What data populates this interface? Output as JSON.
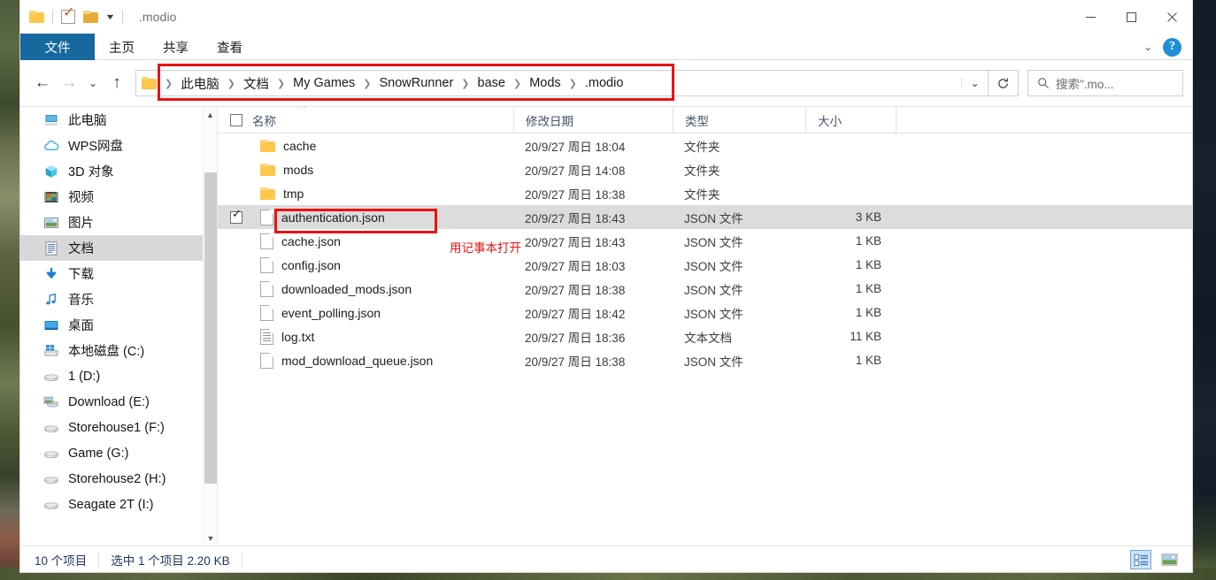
{
  "window": {
    "title": ".modio",
    "quick_access": [
      {
        "name": "folder-icon",
        "label": ""
      },
      {
        "name": "properties-icon",
        "label": ""
      },
      {
        "name": "new-folder-icon",
        "label": ""
      },
      {
        "name": "customize-caret-icon",
        "label": ""
      }
    ],
    "controls": {
      "minimize": "minimize-icon",
      "maximize": "maximize-icon",
      "close": "close-icon"
    }
  },
  "ribbon": {
    "tabs": [
      {
        "label": "文件",
        "active": true
      },
      {
        "label": "主页",
        "active": false
      },
      {
        "label": "共享",
        "active": false
      },
      {
        "label": "查看",
        "active": false
      }
    ],
    "collapse_label": "⌄",
    "help_label": "?"
  },
  "address": {
    "back": "←",
    "forward": "→",
    "recent": "⌄",
    "up": "↑",
    "breadcrumbs": [
      "此电脑",
      "文档",
      "My Games",
      "SnowRunner",
      "base",
      "Mods",
      ".modio"
    ],
    "separator": "❯",
    "dropdown": "⌄",
    "refresh": "↻",
    "search_placeholder": "搜索\".mo..."
  },
  "sidebar": {
    "items": [
      {
        "label": "此电脑",
        "icon": "computer-icon",
        "selected": false
      },
      {
        "label": "WPS网盘",
        "icon": "cloud-icon",
        "selected": false
      },
      {
        "label": "3D 对象",
        "icon": "cube-icon",
        "selected": false
      },
      {
        "label": "视频",
        "icon": "video-icon",
        "selected": false
      },
      {
        "label": "图片",
        "icon": "picture-icon",
        "selected": false
      },
      {
        "label": "文档",
        "icon": "document-icon",
        "selected": true
      },
      {
        "label": "下载",
        "icon": "download-icon",
        "selected": false
      },
      {
        "label": "音乐",
        "icon": "music-icon",
        "selected": false
      },
      {
        "label": "桌面",
        "icon": "desktop-icon",
        "selected": false
      },
      {
        "label": "本地磁盘 (C:)",
        "icon": "system-drive-icon",
        "selected": false
      },
      {
        "label": "1 (D:)",
        "icon": "drive-icon",
        "selected": false
      },
      {
        "label": "Download (E:)",
        "icon": "drive-picture-icon",
        "selected": false
      },
      {
        "label": "Storehouse1 (F:)",
        "icon": "drive-icon",
        "selected": false
      },
      {
        "label": "Game (G:)",
        "icon": "drive-icon",
        "selected": false
      },
      {
        "label": "Storehouse2 (H:)",
        "icon": "drive-icon",
        "selected": false
      },
      {
        "label": "Seagate 2T (I:)",
        "icon": "drive-icon",
        "selected": false
      }
    ]
  },
  "filelist": {
    "columns": [
      "名称",
      "修改日期",
      "类型",
      "大小"
    ],
    "sort_indicator": "⌃",
    "rows": [
      {
        "name": "cache",
        "date": "20/9/27 周日 18:04",
        "type": "文件夹",
        "size": "",
        "kind": "folder",
        "checked": false,
        "selected": false
      },
      {
        "name": "mods",
        "date": "20/9/27 周日 14:08",
        "type": "文件夹",
        "size": "",
        "kind": "folder",
        "checked": false,
        "selected": false
      },
      {
        "name": "tmp",
        "date": "20/9/27 周日 18:38",
        "type": "文件夹",
        "size": "",
        "kind": "folder",
        "checked": false,
        "selected": false
      },
      {
        "name": "authentication.json",
        "date": "20/9/27 周日 18:43",
        "type": "JSON 文件",
        "size": "3 KB",
        "kind": "file",
        "checked": true,
        "selected": true
      },
      {
        "name": "cache.json",
        "date": "20/9/27 周日 18:43",
        "type": "JSON 文件",
        "size": "1 KB",
        "kind": "file",
        "checked": false,
        "selected": false
      },
      {
        "name": "config.json",
        "date": "20/9/27 周日 18:03",
        "type": "JSON 文件",
        "size": "1 KB",
        "kind": "file",
        "checked": false,
        "selected": false
      },
      {
        "name": "downloaded_mods.json",
        "date": "20/9/27 周日 18:38",
        "type": "JSON 文件",
        "size": "1 KB",
        "kind": "file",
        "checked": false,
        "selected": false
      },
      {
        "name": "event_polling.json",
        "date": "20/9/27 周日 18:42",
        "type": "JSON 文件",
        "size": "1 KB",
        "kind": "file",
        "checked": false,
        "selected": false
      },
      {
        "name": "log.txt",
        "date": "20/9/27 周日 18:36",
        "type": "文本文档",
        "size": "11 KB",
        "kind": "text",
        "checked": false,
        "selected": false
      },
      {
        "name": "mod_download_queue.json",
        "date": "20/9/27 周日 18:38",
        "type": "JSON 文件",
        "size": "1 KB",
        "kind": "file",
        "checked": false,
        "selected": false
      }
    ]
  },
  "status": {
    "item_count": "10 个项目",
    "selection": "选中 1 个项目  2.20 KB",
    "views": [
      {
        "name": "details-view-button",
        "active": true
      },
      {
        "name": "large-icons-view-button",
        "active": false
      }
    ]
  },
  "annotations": {
    "note": "用记事本打开",
    "color": "#e81313"
  }
}
